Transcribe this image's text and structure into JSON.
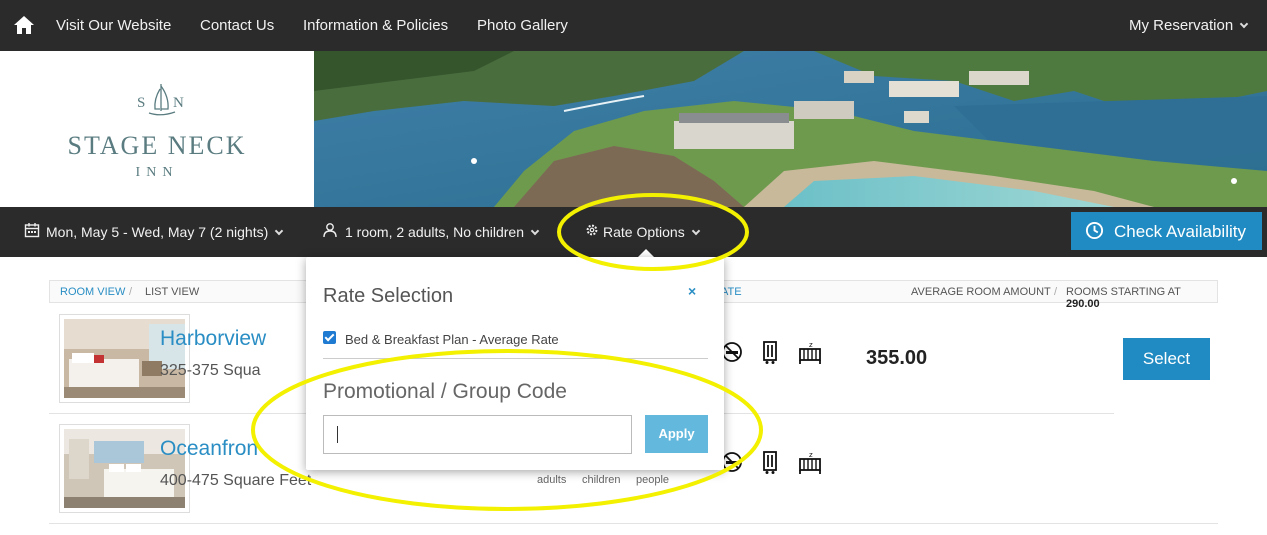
{
  "nav": {
    "links": [
      "Visit Our Website",
      "Contact Us",
      "Information & Policies",
      "Photo Gallery"
    ],
    "my_reservation": "My Reservation"
  },
  "logo": {
    "mark": "SN",
    "name": "STAGE NECK",
    "sub": "INN"
  },
  "search": {
    "dates": "Mon, May 5 - Wed, May 7 (2 nights)",
    "guests": "1 room, 2 adults, No children",
    "rate_options": "Rate Options",
    "check_availability": "Check Availability"
  },
  "breadcrumb": {
    "room_view": "ROOM VIEW",
    "list_view": "LIST VIEW",
    "rate_fragment": "ATE",
    "average": "AVERAGE ROOM AMOUNT",
    "starting": "ROOMS STARTING AT",
    "starting_value": "290.00"
  },
  "rooms": [
    {
      "name": "Harborview",
      "size": "325-375 Squa",
      "price": "355.00",
      "select": "Select"
    },
    {
      "name": "Oceanfron",
      "size": "400-475 Square Feet",
      "occupancy_labels": [
        "adults",
        "children",
        "people"
      ]
    }
  ],
  "popover": {
    "title": "Rate Selection",
    "close": "×",
    "option_label": "Bed & Breakfast Plan - Average Rate",
    "option_checked": true,
    "promo_heading": "Promotional / Group Code",
    "promo_value": "",
    "apply": "Apply"
  },
  "colors": {
    "nav_bg": "#2b2b2b",
    "accent": "#1f8bc2",
    "apply": "#62b8dd",
    "highlight": "#f3f000"
  }
}
